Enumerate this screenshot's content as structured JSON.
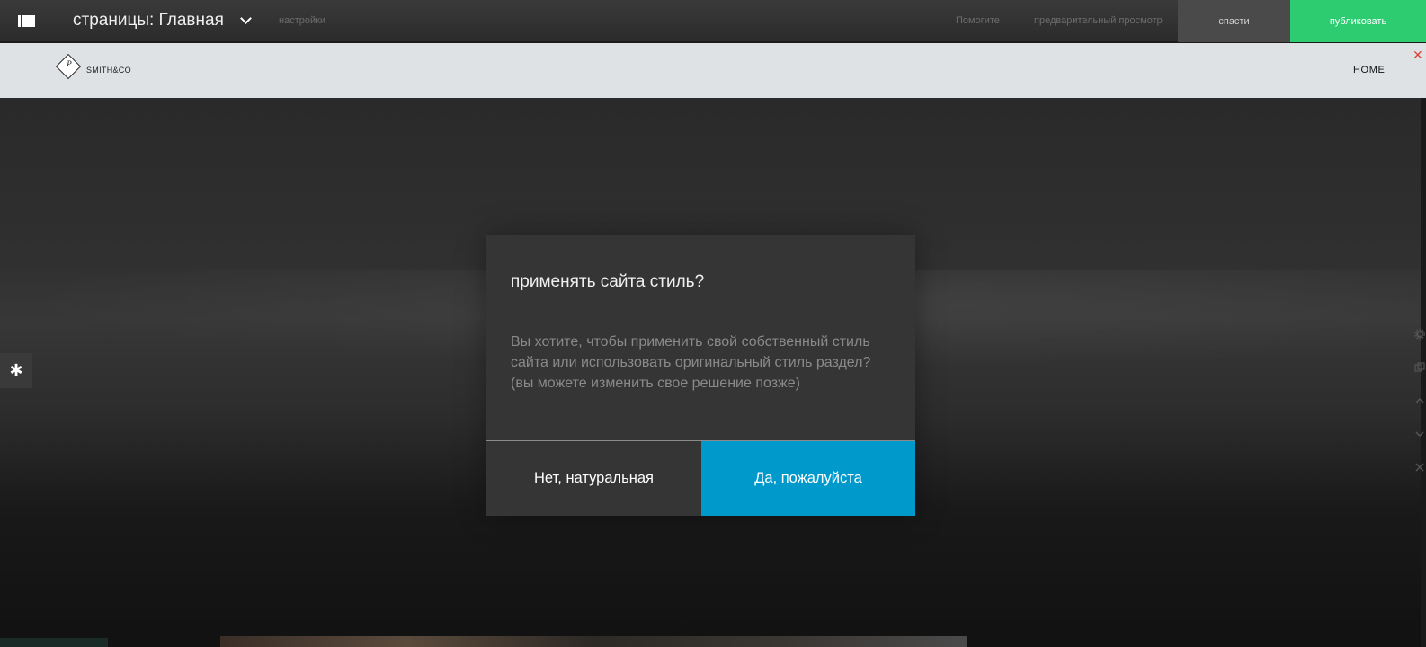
{
  "toolbar": {
    "page_prefix": "страницы: Главная",
    "settings_label": "настройки",
    "help_label": "Помогите",
    "preview_label": "предварительный просмотр",
    "save_label": "спасти",
    "publish_label": "публиковать"
  },
  "site": {
    "logo_letter": "P",
    "brand_name": "SMITH&CO",
    "nav_home": "HOME",
    "close_glyph": "✕"
  },
  "section_tools": {
    "gear_glyph": "✱"
  },
  "dialog": {
    "title": "применять сайта стиль?",
    "body": "Вы хотите, чтобы применить свой собственный стиль сайта или использовать оригинальный стиль раздел? (вы можете изменить свое решение позже)",
    "no_label": "Нет, натуральная",
    "yes_label": "Да, пожалуйста"
  },
  "colors": {
    "publish": "#2ecc71",
    "primary_button": "#0099cc",
    "close": "#d9443a"
  },
  "icons": {
    "menu_toggle": "sidebar-toggle-icon",
    "page_dropdown": "chevron-down-icon",
    "section_settings": "gear-icon",
    "rail": [
      "gear-icon",
      "copy-icon",
      "chevron-up-icon",
      "chevron-down-icon",
      "close-icon"
    ]
  }
}
